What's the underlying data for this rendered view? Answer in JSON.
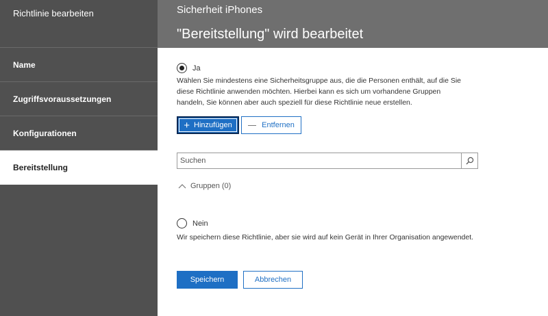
{
  "sidebar": {
    "title": "Richtlinie bearbeiten",
    "items": [
      {
        "label": "Name"
      },
      {
        "label": "Zugriffsvoraussetzungen"
      },
      {
        "label": "Konfigurationen"
      },
      {
        "label": "Bereitstellung"
      }
    ]
  },
  "header": {
    "subtitle": "Sicherheit iPhones",
    "title": "\"Bereitstellung\" wird bearbeitet"
  },
  "main": {
    "option_yes": {
      "label": "Ja",
      "selected": true,
      "description": "Wählen Sie mindestens eine Sicherheitsgruppe aus, die die Personen enthält, auf die Sie diese Richtlinie anwenden möchten. Hierbei kann es sich um vorhandene Gruppen handeln, Sie können aber auch speziell für diese Richtlinie neue erstellen."
    },
    "add_button": "Hinzufügen",
    "remove_button": "Entfernen",
    "search": {
      "placeholder": "Suchen",
      "value": ""
    },
    "groups_toggle": "Gruppen (0)",
    "option_no": {
      "label": "Nein",
      "selected": false,
      "description": "Wir speichern diese Richtlinie, aber sie wird auf kein Gerät in Ihrer Organisation angewendet."
    },
    "save_button": "Speichern",
    "cancel_button": "Abbrechen"
  },
  "icons": {
    "add": "plus-icon",
    "remove": "minus-icon",
    "search": "search-icon",
    "groups": "chevron-up-icon"
  },
  "colors": {
    "primary": "#1e6fc4",
    "sidebar_bg": "#505050",
    "header_bg": "#6f6f6f"
  }
}
